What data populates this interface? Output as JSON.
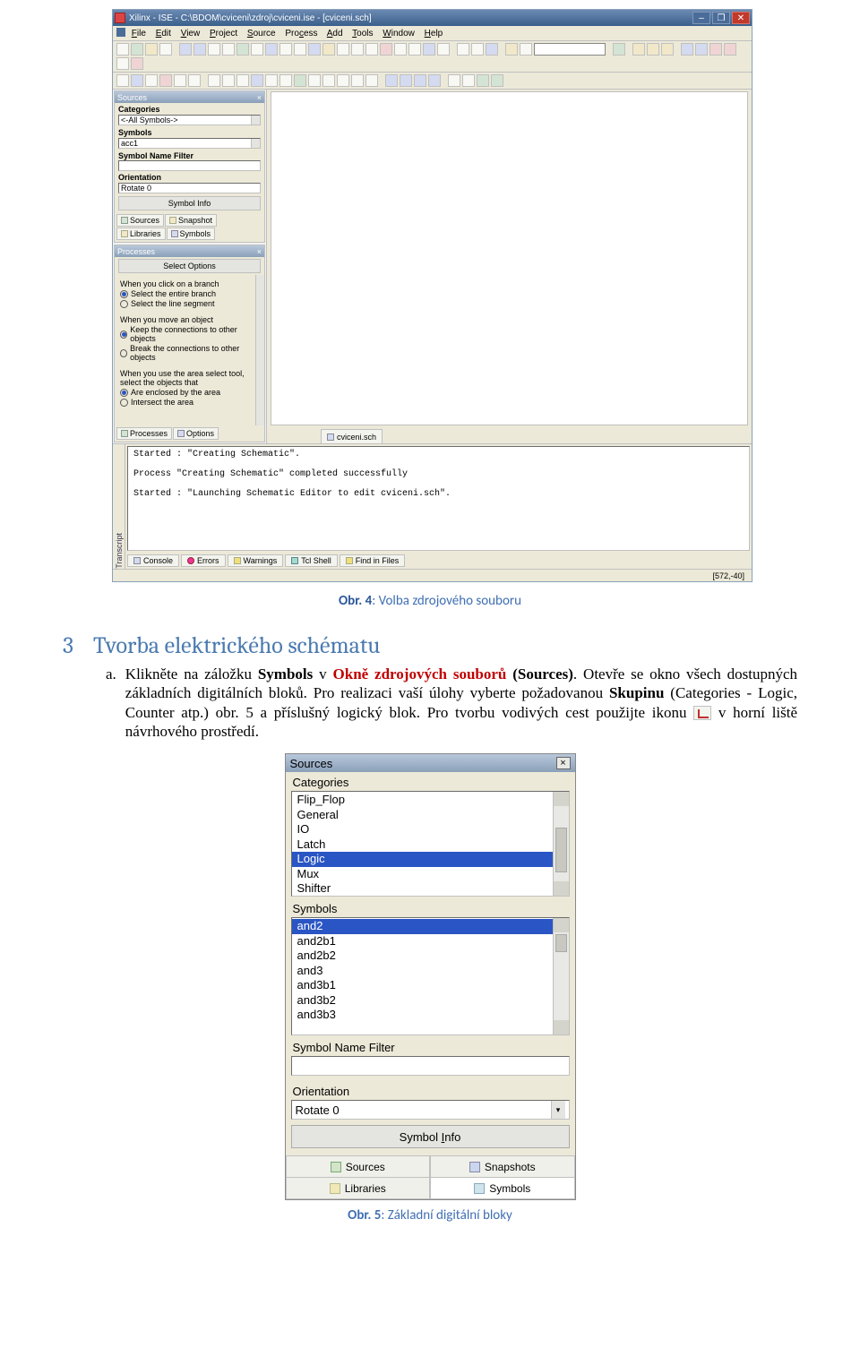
{
  "app": {
    "title": "Xilinx - ISE - C:\\BDOM\\cviceni\\zdroj\\cviceni.ise - [cviceni.sch]",
    "menus": [
      "File",
      "Edit",
      "View",
      "Project",
      "Source",
      "Process",
      "Add",
      "Tools",
      "Window",
      "Help"
    ],
    "document_tab": "cviceni.sch",
    "statusbar_coords": "[572,-40]"
  },
  "sources": {
    "panel_title": "Sources",
    "categories_label": "Categories",
    "categories_value": "<-All Symbols->",
    "symbols_label": "Symbols",
    "symbols_value": "acc1",
    "filter_label": "Symbol Name Filter",
    "orientation_label": "Orientation",
    "orientation_value": "Rotate 0",
    "symbol_info_btn": "Symbol Info",
    "tabs": [
      "Sources",
      "Snapshot",
      "Libraries",
      "Symbols"
    ]
  },
  "processes": {
    "panel_title": "Processes",
    "select_options_btn": "Select Options",
    "group1_hdr": "When you click on a branch",
    "group1_opts": [
      "Select the entire branch",
      "Select the line segment"
    ],
    "group2_hdr": "When you move an object",
    "group2_opts": [
      "Keep the connections to other objects",
      "Break the connections to other objects"
    ],
    "group3_hdr": "When you use the area select tool, select the objects that",
    "group3_opts": [
      "Are enclosed by the area",
      "Intersect the area"
    ],
    "tabs": [
      "Processes",
      "Options"
    ]
  },
  "console": {
    "vtab": "Transcript",
    "line1": "Started : \"Creating Schematic\".",
    "line2": "Process \"Creating Schematic\" completed successfully",
    "line3": "Started : \"Launching Schematic Editor to edit cviceni.sch\".",
    "tabs": [
      "Console",
      "Errors",
      "Warnings",
      "Tcl Shell",
      "Find in Files"
    ]
  },
  "doc": {
    "caption1_prefix": "Obr. 4",
    "caption1_rest": ": Volba zdrojového souboru",
    "section_num": "3",
    "section_title": "Tvorba elektrického schématu",
    "para_a": "a.",
    "para_part1": "Klikněte na záložku ",
    "para_symbols": "Symbols",
    "para_part2": " v ",
    "para_okne": "Okně zdrojových souborů",
    "para_sources": " (Sources)",
    "para_part3": ". Otevře se okno všech dostupných základních digitálních bloků. Pro realizaci vaší úlohy vyberte požadovanou ",
    "para_skupinu": "Skupinu",
    "para_part4": " (Categories - Logic, Counter atp.) obr. 5 a příslušný logický blok. Pro tvorbu vodivých cest použijte ikonu ",
    "para_part5": " v horní liště návrhového prostředí.",
    "caption2_prefix": "Obr. 5",
    "caption2_rest": ": Základní digitální bloky"
  },
  "srcpanel": {
    "title": "Sources",
    "close": "×",
    "categories_label": "Categories",
    "categories": [
      "Flip_Flop",
      "General",
      "IO",
      "Latch",
      "Logic",
      "Mux",
      "Shifter"
    ],
    "categories_selected": "Logic",
    "symbols_label": "Symbols",
    "symbols": [
      "and2",
      "and2b1",
      "and2b2",
      "and3",
      "and3b1",
      "and3b2",
      "and3b3"
    ],
    "symbols_selected": "and2",
    "filter_label": "Symbol Name Filter",
    "orientation_label": "Orientation",
    "orientation_value": "Rotate 0",
    "symbol_info_btn": "Symbol Info",
    "tabs": [
      "Sources",
      "Snapshots",
      "Libraries",
      "Symbols"
    ]
  }
}
